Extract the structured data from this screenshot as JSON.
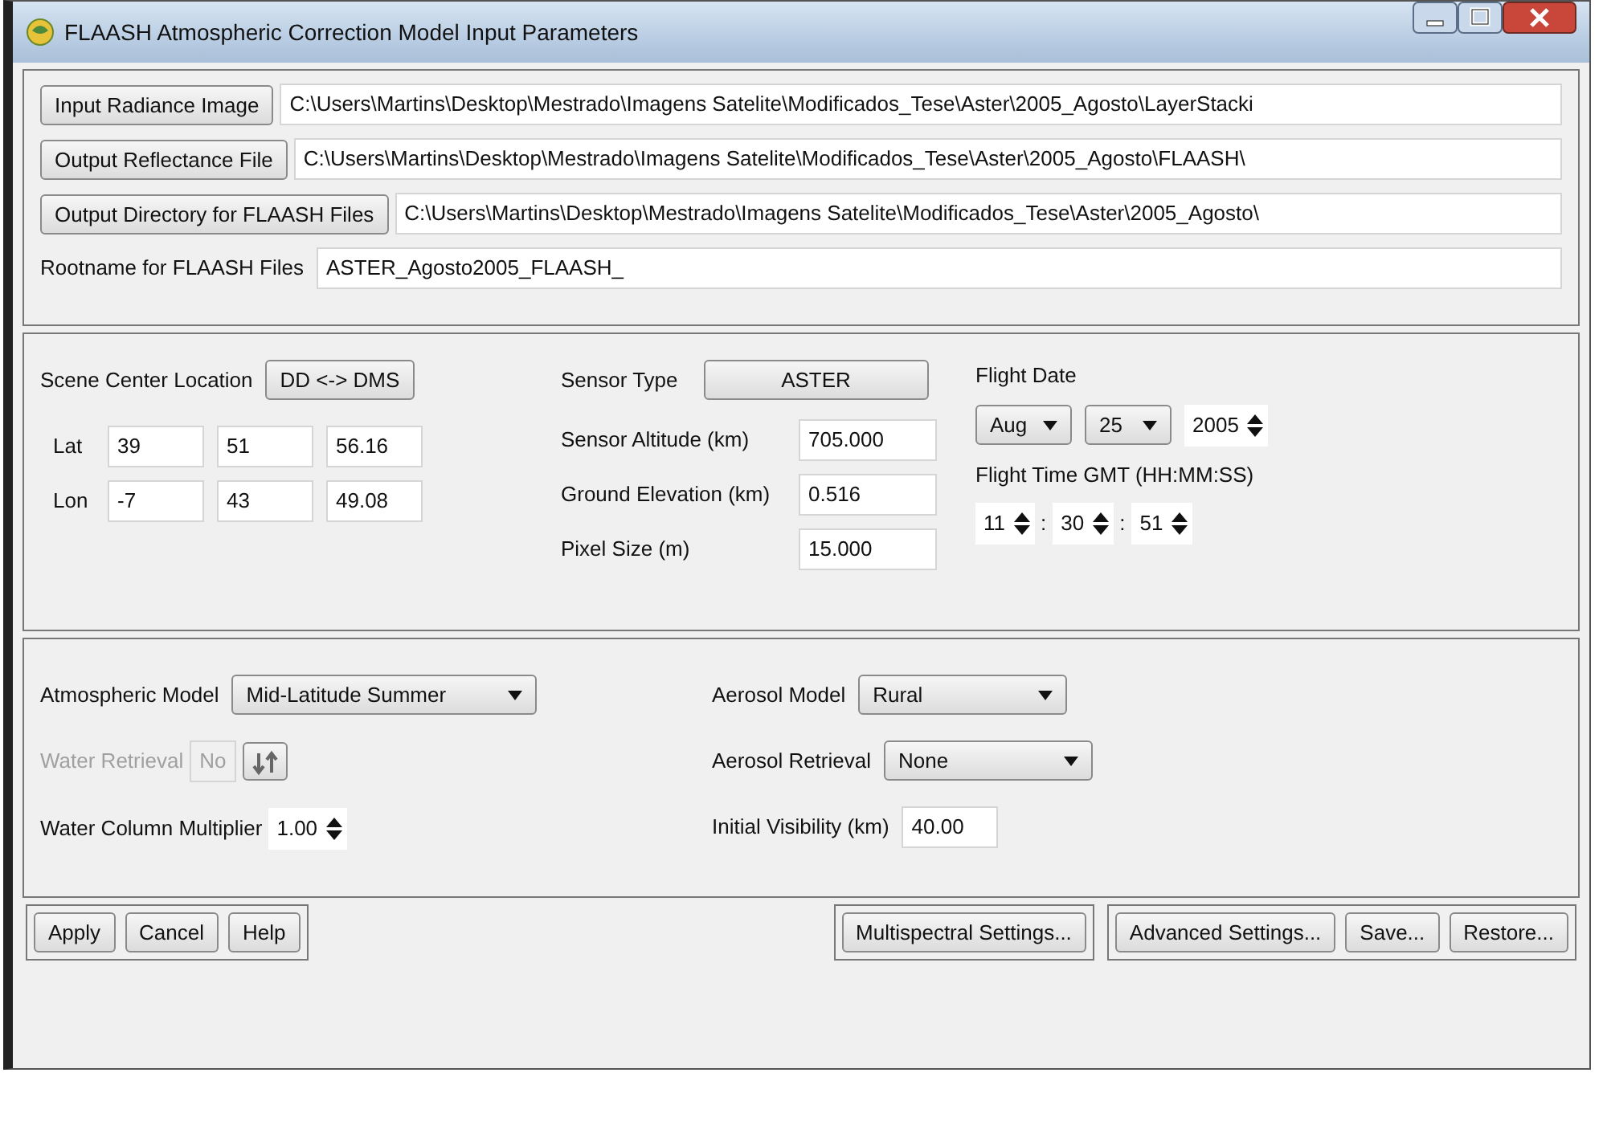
{
  "window": {
    "title": "FLAASH Atmospheric Correction Model Input Parameters"
  },
  "files": [
    {
      "button": "Input Radiance Image",
      "value": "C:\\Users\\Martins\\Desktop\\Mestrado\\Imagens Satelite\\Modificados_Tese\\Aster\\2005_Agosto\\LayerStacki"
    },
    {
      "button": "Output Reflectance File",
      "value": "C:\\Users\\Martins\\Desktop\\Mestrado\\Imagens Satelite\\Modificados_Tese\\Aster\\2005_Agosto\\FLAASH\\"
    },
    {
      "button": "Output Directory for FLAASH Files",
      "value": "C:\\Users\\Martins\\Desktop\\Mestrado\\Imagens Satelite\\Modificados_Tese\\Aster\\2005_Agosto\\"
    }
  ],
  "rootname": {
    "label": "Rootname for FLAASH Files",
    "value": "ASTER_Agosto2005_FLAASH_"
  },
  "scene": {
    "label": "Scene Center Location",
    "toggle": "DD <-> DMS",
    "coords": [
      {
        "label": "Lat",
        "values": [
          "39",
          "51",
          "56.16"
        ]
      },
      {
        "label": "Lon",
        "values": [
          "-7",
          "43",
          "49.08"
        ]
      }
    ]
  },
  "sensor": {
    "label": "Sensor Type",
    "value": "ASTER",
    "fields": [
      {
        "label": "Sensor Altitude (km)",
        "value": "705.000"
      },
      {
        "label": "Ground Elevation (km)",
        "value": "0.516"
      },
      {
        "label": "Pixel Size (m)",
        "value": "15.000"
      }
    ]
  },
  "flight": {
    "date_label": "Flight Date",
    "month": "Aug",
    "day": "25",
    "year": "2005",
    "time_label": "Flight Time GMT (HH:MM:SS)",
    "time": [
      "11",
      "30",
      "51"
    ],
    "separators": [
      ":",
      ":"
    ]
  },
  "atmosphere": {
    "model": {
      "label": "Atmospheric Model",
      "value": "Mid-Latitude Summer"
    },
    "water_retrieval": {
      "label": "Water Retrieval",
      "value": "No",
      "disabled": true
    },
    "water_multiplier": {
      "label": "Water Column Multiplier",
      "value": "1.00"
    },
    "aerosol_model": {
      "label": "Aerosol Model",
      "value": "Rural"
    },
    "aerosol_retrieval": {
      "label": "Aerosol Retrieval",
      "value": "None"
    },
    "visibility": {
      "label": "Initial Visibility (km)",
      "value": "40.00"
    }
  },
  "button_groups": [
    [
      "Apply",
      "Cancel",
      "Help"
    ],
    [
      "Multispectral Settings..."
    ],
    [
      "Advanced Settings...",
      "Save...",
      "Restore..."
    ]
  ]
}
